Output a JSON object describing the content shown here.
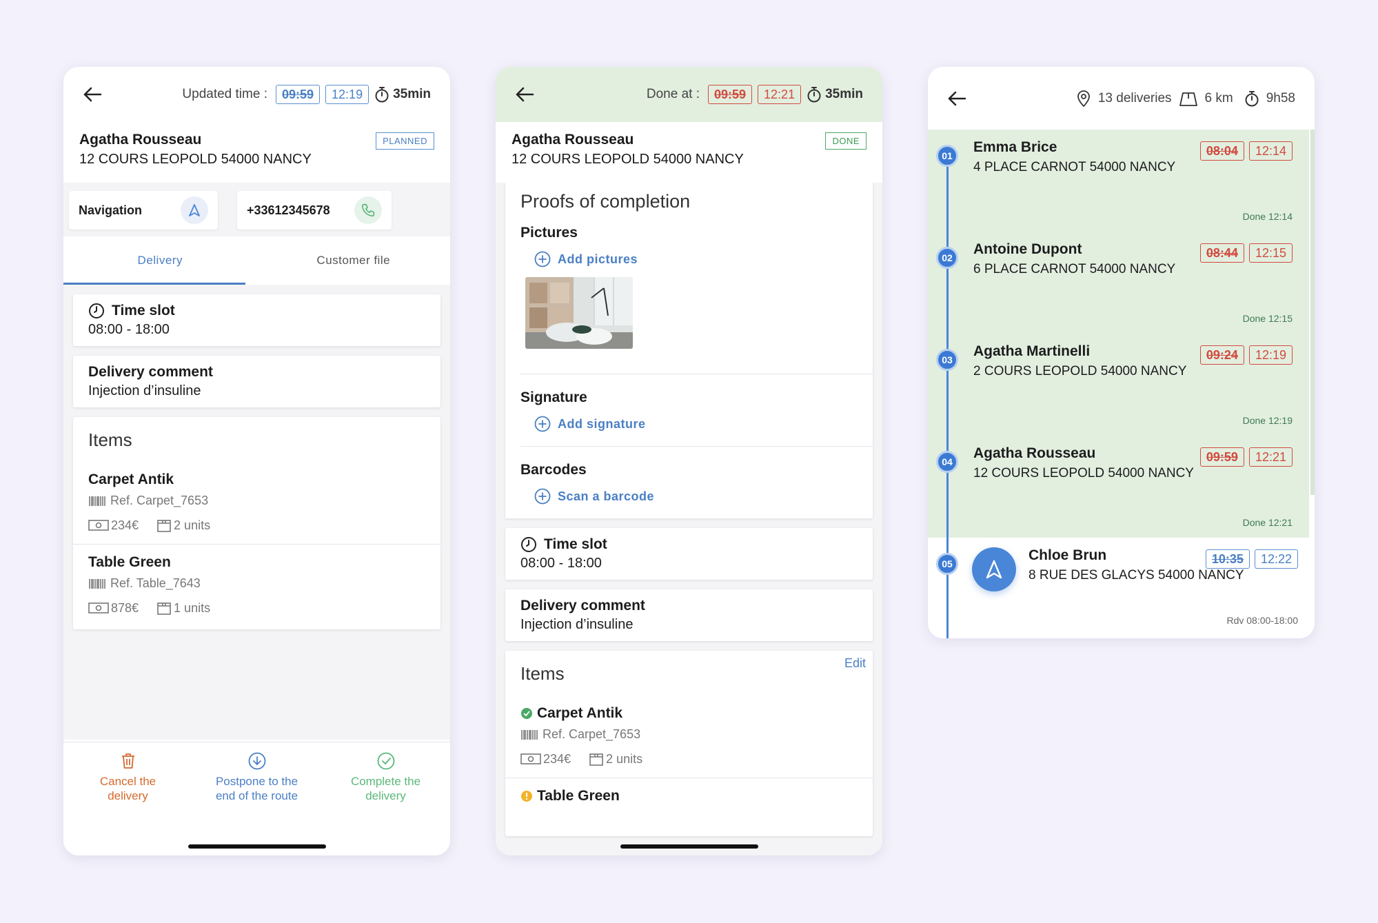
{
  "screen1": {
    "header": {
      "label": "Updated time :",
      "planned_time": "09:59",
      "updated_time": "12:19",
      "duration": "35min"
    },
    "customer": {
      "name": "Agatha Rousseau",
      "address": "12 COURS LEOPOLD 54000 NANCY",
      "status": "PLANNED"
    },
    "actions": {
      "navigation": "Navigation",
      "phone": "+33612345678"
    },
    "tabs": [
      {
        "label": "Delivery"
      },
      {
        "label": "Customer file"
      }
    ],
    "time_slot": {
      "title": "Time slot",
      "value": "08:00 - 18:00"
    },
    "comment": {
      "title": "Delivery comment",
      "value": "Injection d’insuline"
    },
    "items": {
      "title": "Items",
      "list": [
        {
          "name": "Carpet Antik",
          "ref": "Ref. Carpet_7653",
          "price": "234€",
          "units": "2 units"
        },
        {
          "name": "Table Green",
          "ref": "Ref. Table_7643",
          "price": "878€",
          "units": "1 units"
        }
      ]
    },
    "footer": {
      "cancel": "Cancel the delivery",
      "postpone": "Postpone to the end of the route",
      "complete": "Complete the delivery"
    }
  },
  "screen2": {
    "header": {
      "label": "Done at :",
      "planned_time": "09:59",
      "done_time": "12:21",
      "duration": "35min"
    },
    "customer": {
      "name": "Agatha Rousseau",
      "address": "12 COURS LEOPOLD 54000 NANCY",
      "status": "DONE"
    },
    "proofs": {
      "title": "Proofs of completion",
      "pictures": {
        "title": "Pictures",
        "action": "Add pictures"
      },
      "signature": {
        "title": "Signature",
        "action": "Add signature"
      },
      "barcodes": {
        "title": "Barcodes",
        "action": "Scan a barcode"
      }
    },
    "time_slot": {
      "title": "Time slot",
      "value": "08:00 - 18:00"
    },
    "comment": {
      "title": "Delivery comment",
      "value": "Injection d’insuline"
    },
    "items": {
      "title": "Items",
      "edit": "Edit",
      "list": [
        {
          "name": "Carpet Antik",
          "ref": "Ref. Carpet_7653",
          "price": "234€",
          "units": "2 units",
          "status_color": "#4aa866"
        },
        {
          "name": "Table Green",
          "status_color": "#f2b32a"
        }
      ]
    }
  },
  "screen3": {
    "header": {
      "deliveries": "13 deliveries",
      "distance": "6 km",
      "duration": "9h58"
    },
    "stops": [
      {
        "num": "01",
        "name": "Emma Brice",
        "address": "4 PLACE CARNOT 54000 NANCY",
        "planned": "08:04",
        "actual": "12:14",
        "done": "Done 12:14"
      },
      {
        "num": "02",
        "name": "Antoine Dupont",
        "address": "6 PLACE CARNOT 54000 NANCY",
        "planned": "08:44",
        "actual": "12:15",
        "done": "Done 12:15"
      },
      {
        "num": "03",
        "name": "Agatha Martinelli",
        "address": "2 COURS LEOPOLD 54000 NANCY",
        "planned": "09:24",
        "actual": "12:19",
        "done": "Done 12:19"
      },
      {
        "num": "04",
        "name": "Agatha Rousseau",
        "address": "12 COURS LEOPOLD 54000 NANCY",
        "planned": "09:59",
        "actual": "12:21",
        "done": "Done 12:21"
      }
    ],
    "current": {
      "num": "05",
      "name": "Chloe Brun",
      "address": "8 RUE DES GLACYS 54000 NANCY",
      "planned": "10:35",
      "actual": "12:22",
      "rdv": "Rdv 08:00-18:00"
    }
  },
  "colors": {
    "accent_blue": "#4a7fc4",
    "done_green_bg": "#e2efdf",
    "late_red": "#d24a3f",
    "cancel_orange": "#d66a2e",
    "complete_green": "#5cb77a"
  }
}
